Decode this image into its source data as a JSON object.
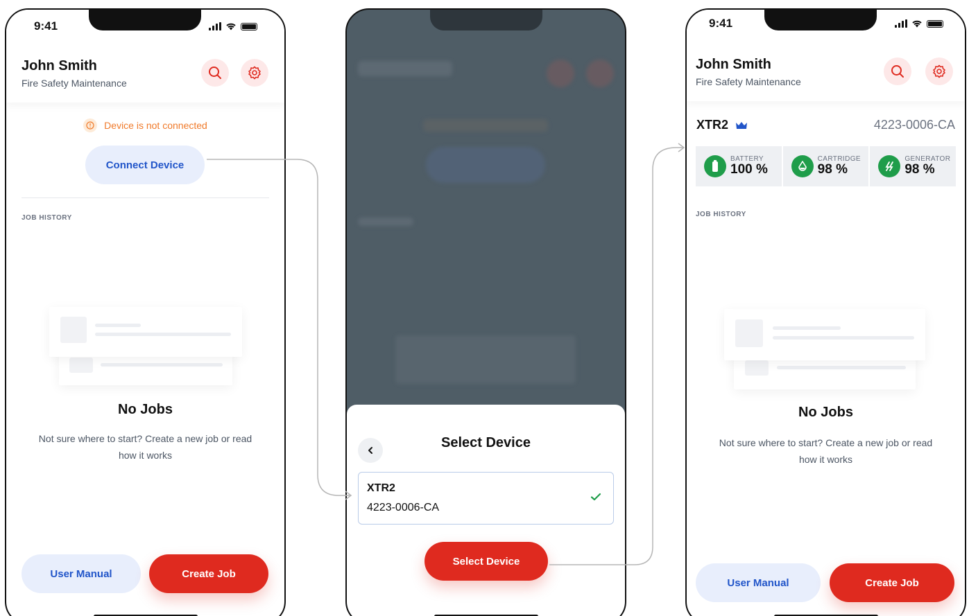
{
  "status": {
    "time": "9:41"
  },
  "user": {
    "name": "John Smith",
    "role": "Fire Safety Maintenance"
  },
  "icons": {
    "search": "search-icon",
    "settings": "gear-icon",
    "warning": "alert-circle-icon",
    "back": "chevron-left-icon",
    "check": "check-icon",
    "crown": "crown-icon"
  },
  "colors": {
    "accent_red": "#df2a1f",
    "accent_blue": "#2155c9",
    "warning": "#f07a2a",
    "success": "#1f9d4a"
  },
  "screen1": {
    "warning_text": "Device is not connected",
    "connect_label": "Connect Device",
    "section_label": "JOB HISTORY",
    "empty_title": "No Jobs",
    "empty_sub": "Not sure where to start? Create a new job or read how it works",
    "manual_label": "User Manual",
    "create_label": "Create Job"
  },
  "screen2": {
    "sheet_title": "Select Device",
    "device": {
      "name": "XTR2",
      "serial": "4223-0006-CA",
      "selected": true
    },
    "select_label": "Select Device"
  },
  "screen3": {
    "device": {
      "name": "XTR2",
      "serial": "4223-0006-CA"
    },
    "stats": [
      {
        "label": "BATTERY",
        "value": "100 %",
        "icon": "battery-icon"
      },
      {
        "label": "CARTRIDGE",
        "value": "98 %",
        "icon": "drop-icon"
      },
      {
        "label": "GENERATOR",
        "value": "98 %",
        "icon": "generator-icon"
      }
    ],
    "section_label": "JOB HISTORY",
    "empty_title": "No Jobs",
    "empty_sub": "Not sure where to start? Create a new job or read how it works",
    "manual_label": "User Manual",
    "create_label": "Create Job"
  }
}
